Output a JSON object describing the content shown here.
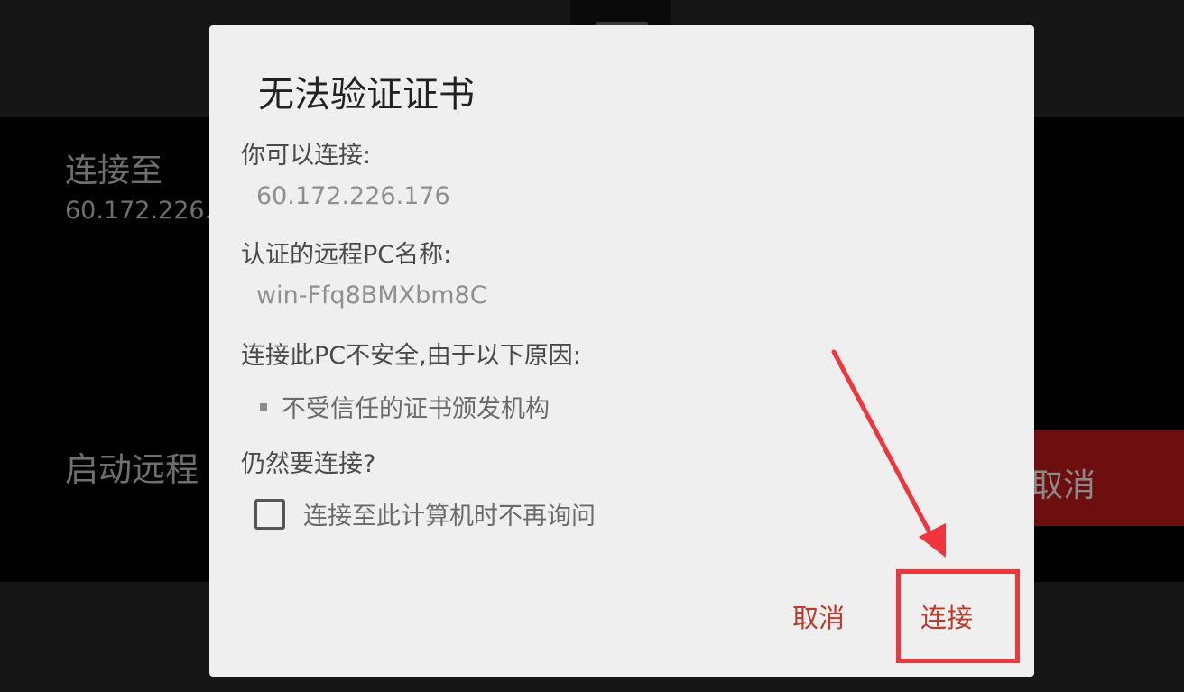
{
  "background": {
    "connect_to_label": "连接至",
    "address": "60.172.226.",
    "start_remote_label": "启动远程",
    "cancel_button_label": "取消"
  },
  "dialog": {
    "title": "无法验证证书",
    "can_connect_label": "你可以连接:",
    "ip_address": "60.172.226.176",
    "pc_name_label": "认证的远程PC名称:",
    "pc_name": "win-Ffq8BMXbm8C",
    "insecure_label": "连接此PC不安全,由于以下原因:",
    "reasons": [
      "不受信任的证书颁发机构"
    ],
    "still_connect_label": "仍然要连接?",
    "dont_ask_checkbox": {
      "label": "连接至此计算机时不再询问",
      "checked": false
    },
    "cancel_button": "取消",
    "connect_button": "连接"
  },
  "annotation": {
    "type": "red-arrow-and-box",
    "target": "connect-button",
    "color": "#f0353c"
  },
  "colors": {
    "accent": "#c0392b",
    "dialog_bg": "#efefef",
    "annotation_red": "#f0353c"
  }
}
